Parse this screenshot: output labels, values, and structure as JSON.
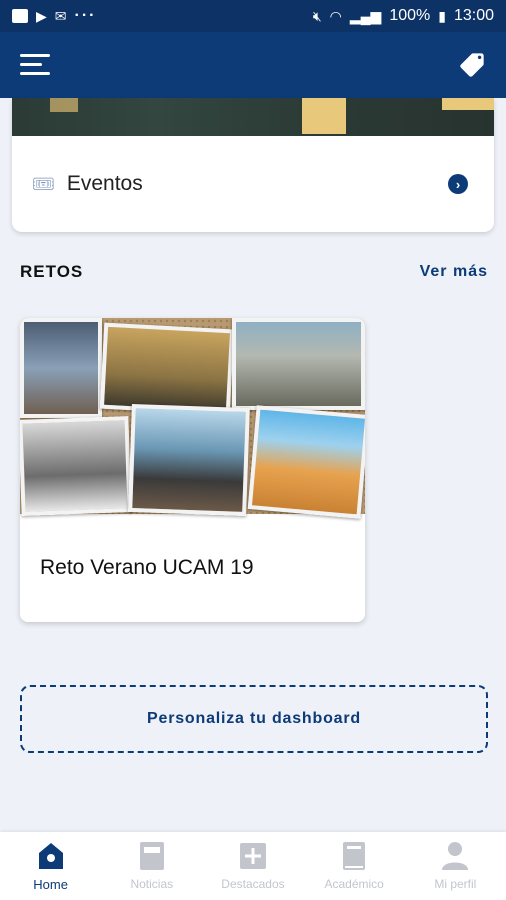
{
  "status_bar": {
    "battery": "100%",
    "time": "13:00"
  },
  "app_bar": {
    "menu_icon": "hamburger-menu-icon",
    "tag_icon": "tag-icon"
  },
  "event_card": {
    "title": "Eventos",
    "icon": "ticket-icon"
  },
  "retos": {
    "section_title": "RETOS",
    "see_more": "Ver más",
    "items": [
      {
        "title": "Reto Verano UCAM 19"
      }
    ]
  },
  "personaliza_label": "Personaliza tu dashboard",
  "bottom_nav": {
    "items": [
      {
        "label": "Home",
        "icon": "home-icon",
        "active": true
      },
      {
        "label": "Noticias",
        "icon": "news-icon",
        "active": false
      },
      {
        "label": "Destacados",
        "icon": "plus-box-icon",
        "active": false
      },
      {
        "label": "Académico",
        "icon": "book-icon",
        "active": false
      },
      {
        "label": "Mi perfil",
        "icon": "person-icon",
        "active": false
      }
    ]
  },
  "colors": {
    "primary": "#0d3b78",
    "status_bar": "#0d3366",
    "background": "#eef2f8",
    "inactive": "#c2c6cc"
  }
}
